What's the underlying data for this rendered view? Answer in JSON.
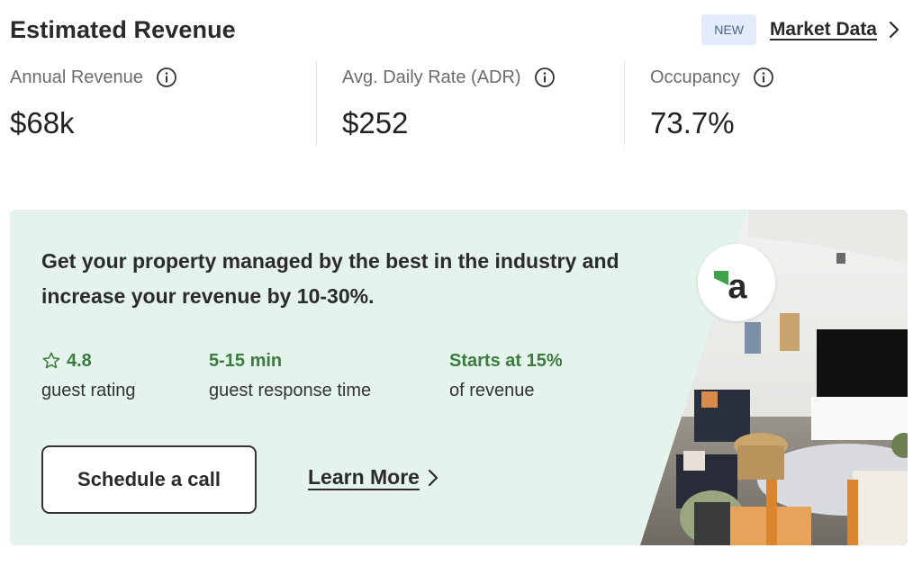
{
  "header": {
    "title": "Estimated Revenue",
    "badge": "NEW",
    "market_link": "Market Data"
  },
  "stats": [
    {
      "label": "Annual Revenue",
      "value": "$68k"
    },
    {
      "label": "Avg. Daily Rate (ADR)",
      "value": "$252"
    },
    {
      "label": "Occupancy",
      "value": "73.7%"
    }
  ],
  "promo": {
    "heading": "Get your property managed by the best in the industry and increase your revenue by 10-30%.",
    "features": [
      {
        "value": "4.8",
        "label": "guest rating",
        "icon": "star-icon"
      },
      {
        "value": "5-15 min",
        "label": "guest response time"
      },
      {
        "value": "Starts at 15%",
        "label": "of revenue"
      }
    ],
    "schedule_label": "Schedule a call",
    "learn_label": "Learn More"
  },
  "colors": {
    "promo_bg": "#e4f4ec",
    "accent_green": "#3c7a3f",
    "badge_bg": "#e3ecfa"
  }
}
